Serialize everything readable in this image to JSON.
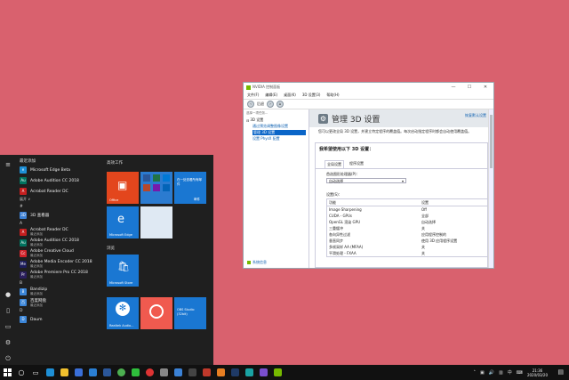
{
  "nvidia": {
    "title": "NVIDIA 控制面板",
    "menu": [
      "文件(F)",
      "编辑(E)",
      "桌面(K)",
      "3D 设置(3)",
      "帮助(H)"
    ],
    "back_label": "后退",
    "tree_caption": "选择一项任务...",
    "tree_root": "3D 设置",
    "tree_items": [
      "通过预览调整图像设置",
      "管理 3D 设置",
      "设置 PhysX 配置"
    ],
    "system_info": "系统信息",
    "page_title": "管理 3D 设置",
    "restore": "恢复默认设置",
    "description": "您可以更改全局 3D 设置，并建立特定程序的覆盖值。每次启动指定程序时都会自动使用覆盖值。",
    "question": "我希望使用以下 3D 设置：",
    "tabs": [
      "全局设置",
      "程序设置"
    ],
    "preferred_label": "首选图形处理器(P)：",
    "preferred_value": "自动选择",
    "settings_label": "设置(S)：",
    "table_header": [
      "功能",
      "设置"
    ],
    "table_rows": [
      [
        "Image Sharpening",
        "Off"
      ],
      [
        "CUDA - GPUs",
        "全部"
      ],
      [
        "OpenGL 渲染 GPU",
        "自动选择"
      ],
      [
        "三重缓冲",
        "关"
      ],
      [
        "各向异性过滤",
        "应用程序控制的"
      ],
      [
        "垂直同步",
        "使用 3D 应用程序设置"
      ],
      [
        "多帧采样 AA (MFAA)",
        "关"
      ],
      [
        "平滑处理 - FXAA",
        "关"
      ]
    ]
  },
  "start_menu": {
    "recent_header": "最近添加",
    "recent_apps": [
      {
        "name": "Microsoft Edge Beta",
        "sub": "",
        "color": "#1e8fd6",
        "glyph": "e"
      },
      {
        "name": "Adobe Audition CC 2018",
        "sub": "",
        "color": "#00735f",
        "glyph": "Au"
      },
      {
        "name": "Acrobat Reader DC",
        "sub": "",
        "color": "#c51f1f",
        "glyph": "A"
      }
    ],
    "expand_label": "展开 ∨",
    "section_hash": "#",
    "hash_apps": [
      {
        "name": "3D 查看器",
        "sub": "",
        "color": "#3b7fd4",
        "glyph": "3D"
      }
    ],
    "section_a": "A",
    "a_apps": [
      {
        "name": "Acrobat Reader DC",
        "sub": "最近添加",
        "color": "#c51f1f",
        "glyph": "A"
      },
      {
        "name": "Adobe Audition CC 2018",
        "sub": "最近添加",
        "color": "#00735f",
        "glyph": "Au"
      },
      {
        "name": "Adobe Creative Cloud",
        "sub": "最近添加",
        "color": "#d2232a",
        "glyph": "Cc"
      },
      {
        "name": "Adobe Media Encoder CC 2018",
        "sub": "最近添加",
        "color": "#1d1d5c",
        "glyph": "Me"
      },
      {
        "name": "Adobe Premiere Pro CC 2018",
        "sub": "最近添加",
        "color": "#2a1e5c",
        "glyph": "Pr"
      }
    ],
    "section_b": "B",
    "b_apps": [
      {
        "name": "Bandizip",
        "sub": "最近添加",
        "color": "#3c86d8",
        "glyph": "B"
      },
      {
        "name": "百度网盘",
        "sub": "最近添加",
        "color": "#3c86d8",
        "glyph": "百"
      }
    ],
    "section_d": "D",
    "d_apps": [
      {
        "name": "Daum",
        "sub": "",
        "color": "#3c86d8",
        "glyph": "D"
      }
    ],
    "tile_groups": [
      "高效工作",
      "浏览"
    ],
    "tiles": {
      "office": "Office",
      "onedrive": "在一处查看所有邮件",
      "mail": "邮件",
      "edge": "Microsoft Edge",
      "store": "Microsoft Store",
      "realtek": "Realtek Audio...",
      "obs": "OBS Studio (32bit)"
    }
  },
  "taskbar": {
    "lang": "中",
    "time": "21:36",
    "date": "2020/03/20"
  }
}
